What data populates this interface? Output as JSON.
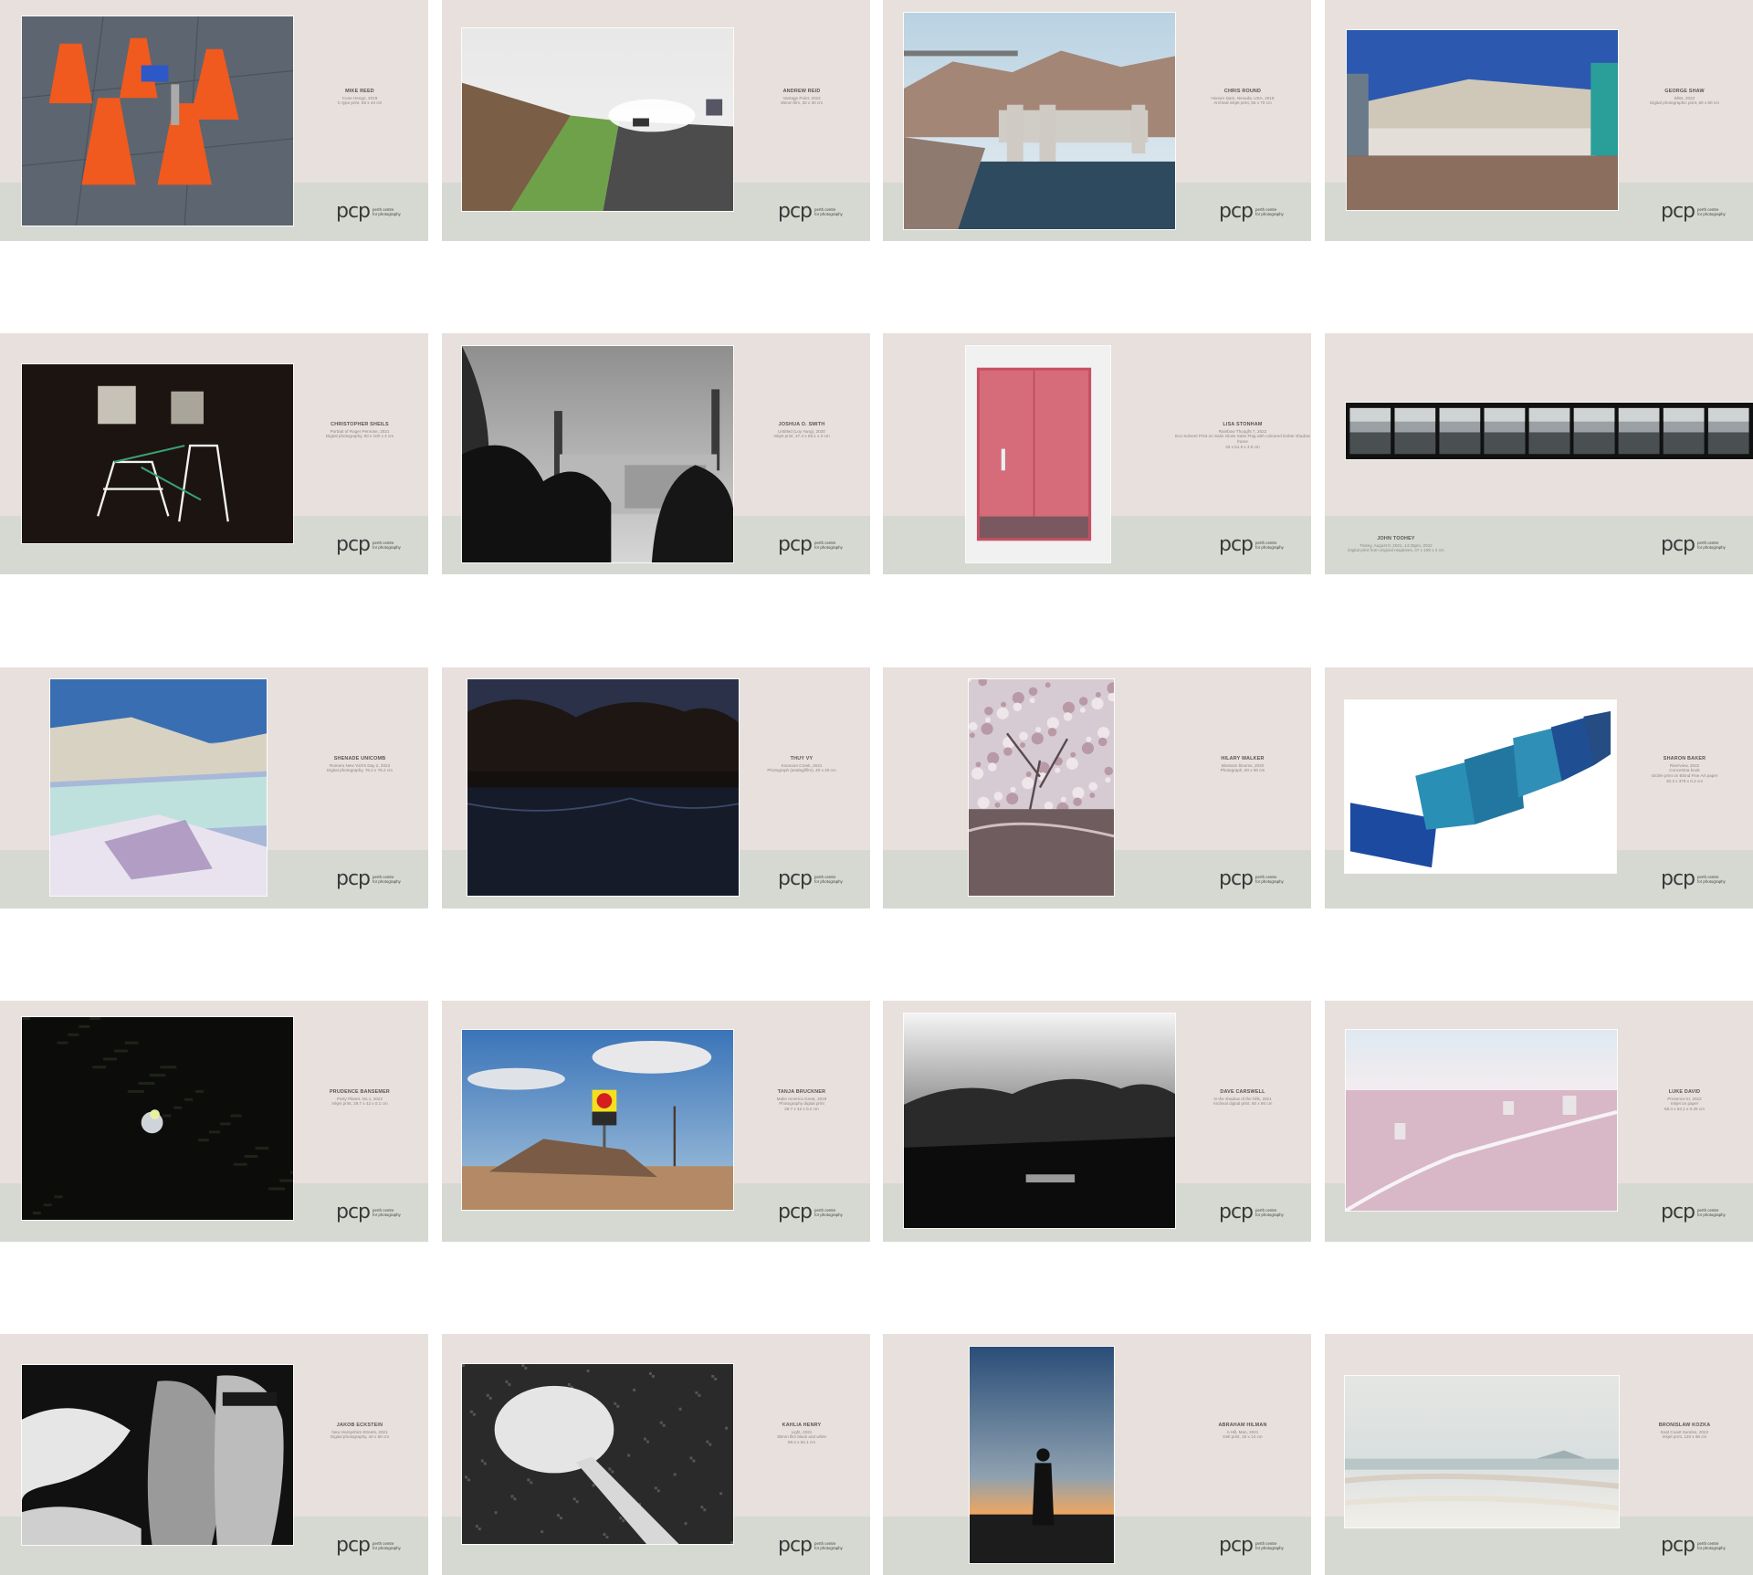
{
  "brand": {
    "mark": "pcp",
    "line1": "perth centre",
    "line2": "for photography"
  },
  "cards": [
    {
      "artist": "MIKE REED",
      "work": "Cone Henge, 2019",
      "medium": "C-type print, 55 x 44 cm"
    },
    {
      "artist": "ANDREW REID",
      "work": "Vantage Point, 2022",
      "medium": "35mm film, 30 x 30 cm"
    },
    {
      "artist": "CHRIS ROUND",
      "work": "Hoover Dam, Nevada, USA, 2019",
      "medium": "Archival inkjet print, 55 x 70 cm"
    },
    {
      "artist": "GEORGE SHAW",
      "work": "Bliss, 2022",
      "medium": "Digital photographic print, 60 x 80 cm"
    },
    {
      "artist": "CHRISTOPHER SHEILS",
      "work": "Portrait of Roger Penrose, 2021",
      "medium": "Digital photography, 60 x 100 x 4 cm"
    },
    {
      "artist": "JOSHUA O. SMITH",
      "work": "Untitled (Loy Yang), 2020",
      "medium": "Inkjet print, 47.4 x 59.1 x 3 cm"
    },
    {
      "artist": "LISA STONHAM",
      "work": "Rainbow Thought 7, 2022",
      "medium": "Eco Solvent Print on Satin Gloss Satin Flag with coloured timber shadow frame",
      "medium2": "33 x 51.5 x 4.5 cm"
    },
    {
      "artist": "JOHN TOOHEY",
      "work": "Tinkey, August 8, 2021, 14:25pm, 2022",
      "medium": "Digital print from original negatives, 37 x 108 x 2 cm"
    },
    {
      "artist": "SHENADE UNICOMB",
      "work": "Romero New York's Day 2, 2022",
      "medium": "Digital photography, 76.2 x 76.2 cm"
    },
    {
      "artist": "THUY VY",
      "work": "Koonoon Creek, 2021",
      "medium": "Photograph (analog/film), 40 x 30 cm"
    },
    {
      "artist": "HILARY WALKER",
      "work": "Blossom blooms, 2020",
      "medium": "Photograph, 90 x 60 cm"
    },
    {
      "artist": "SHARON BAKER",
      "work": "Riverview, 2022",
      "medium": "Concertina book",
      "medium2": "Giclée print on Blond Fine Art paper",
      "medium3": "20.3 x 378 x 0.2 cm"
    },
    {
      "artist": "PRUDENCE BANSEMER",
      "work": "Party Planet, No.1, 2022",
      "medium": "Inkjet print, 29.7 x 42 x 0.1 cm"
    },
    {
      "artist": "TANJA BRUCKNER",
      "work": "Make America Great, 2019",
      "medium": "Photography digital print",
      "medium2": "29.7 x 42 x 0.2 cm"
    },
    {
      "artist": "DAVE CARSWELL",
      "work": "In the shadow of the hills, 2021",
      "medium": "Archival digital print, 60 x 80 cm"
    },
    {
      "artist": "LUKE DAVID",
      "work": "Presence III, 2022",
      "medium": "Inkjet on paper",
      "medium2": "59.4 x 84.1 x 0.25 cm"
    },
    {
      "artist": "JAKOB ECKSTEIN",
      "work": "New Hampshire Streets, 2021",
      "medium": "Digital photography, 40 x 60 cm"
    },
    {
      "artist": "KAHLIA HENRY",
      "work": "Light, 2021",
      "medium": "35mm film black and white",
      "medium2": "59.4 x 84.1 cm"
    },
    {
      "artist": "ABRAHAM HILMAN",
      "work": "A Hill, Man, 2021",
      "medium": "Dell print, 18 x 13 cm"
    },
    {
      "artist": "BRONISLAW KOZKA",
      "work": "East Coast Sunrise, 2022",
      "medium": "Inkjet print, 120 x 68 cm"
    }
  ]
}
